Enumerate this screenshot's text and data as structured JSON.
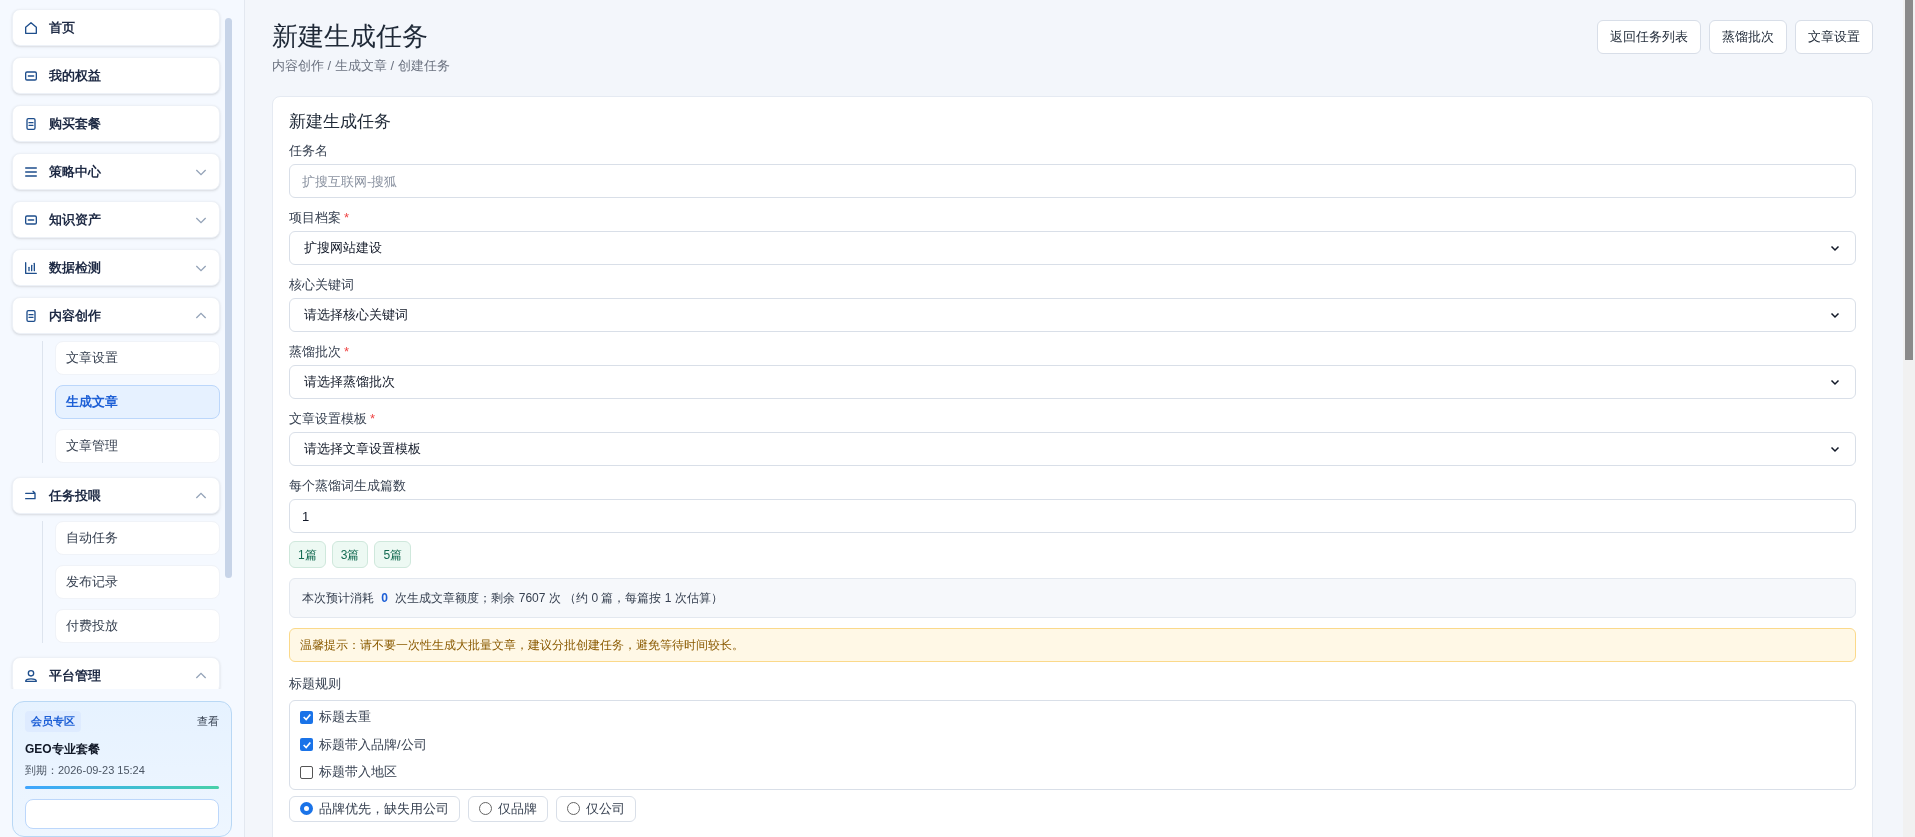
{
  "sidebar": {
    "items": [
      {
        "kind": "link",
        "label": "首页"
      },
      {
        "kind": "link",
        "label": "我的权益"
      },
      {
        "kind": "link",
        "label": "购买套餐"
      },
      {
        "kind": "group",
        "label": "策略中心",
        "expanded": false
      },
      {
        "kind": "group",
        "label": "知识资产",
        "expanded": false
      },
      {
        "kind": "group",
        "label": "数据检测",
        "expanded": false
      },
      {
        "kind": "group",
        "label": "内容创作",
        "expanded": true,
        "children": [
          {
            "label": "文章设置",
            "selected": false
          },
          {
            "label": "生成文章",
            "selected": true
          },
          {
            "label": "文章管理",
            "selected": false
          }
        ]
      },
      {
        "kind": "group",
        "label": "任务投喂",
        "expanded": true,
        "children": [
          {
            "label": "自动任务",
            "selected": false
          },
          {
            "label": "发布记录",
            "selected": false
          },
          {
            "label": "付费投放",
            "selected": false
          }
        ]
      },
      {
        "kind": "group",
        "label": "平台管理",
        "expanded": true
      }
    ],
    "member_card": {
      "badge": "会员专区",
      "link": "查看",
      "plan": "GEO专业套餐",
      "expiry": "到期：2026-09-23 15:24",
      "level": 1
    }
  },
  "header": {
    "title": "新建生成任务",
    "breadcrumb": "内容创作 / 生成文章 / 创建任务",
    "buttons": [
      "返回任务列表",
      "蒸馏批次",
      "文章设置"
    ]
  },
  "form": {
    "title": "新建生成任务",
    "fields": [
      {
        "kind": "text",
        "label": "任务名",
        "placeholder": "扩搜互联网-搜狐"
      },
      {
        "kind": "select",
        "label": "项目档案",
        "required_mark": "*",
        "value": "扩搜网站建设"
      },
      {
        "kind": "select",
        "label": "核心关键词",
        "value": "请选择核心关键词"
      },
      {
        "kind": "select",
        "label": "蒸馏批次",
        "required_mark": "*",
        "value": "请选择蒸馏批次"
      },
      {
        "kind": "select",
        "label": "文章设置模板",
        "required_mark": "*",
        "value": "请选择文章设置模板"
      },
      {
        "kind": "text",
        "label": "每个蒸馏词生成篇数",
        "value": "1"
      }
    ],
    "chips": [
      "1篇",
      "3篇",
      "5篇"
    ],
    "estimate": "本次预计消耗 **0** 次生成文章额度；剩余 7607 次 （约 0 篇，每篇按 1 次估算）",
    "warning": "温馨提示：请不要一次性生成大批量文章，建议分批创建任务，避免等待时间较长。",
    "title_rules": {
      "label": "标题规则",
      "options": [
        {
          "label": "标题去重",
          "checked": true
        },
        {
          "label": "标题带入品牌/公司",
          "checked": true
        },
        {
          "label": "标题带入地区",
          "checked": false
        }
      ]
    },
    "name_modes": [
      {
        "label": "品牌优先，缺失用公司",
        "selected": true
      },
      {
        "label": "仅品牌",
        "selected": false
      },
      {
        "label": "仅公司",
        "selected": false
      }
    ]
  }
}
